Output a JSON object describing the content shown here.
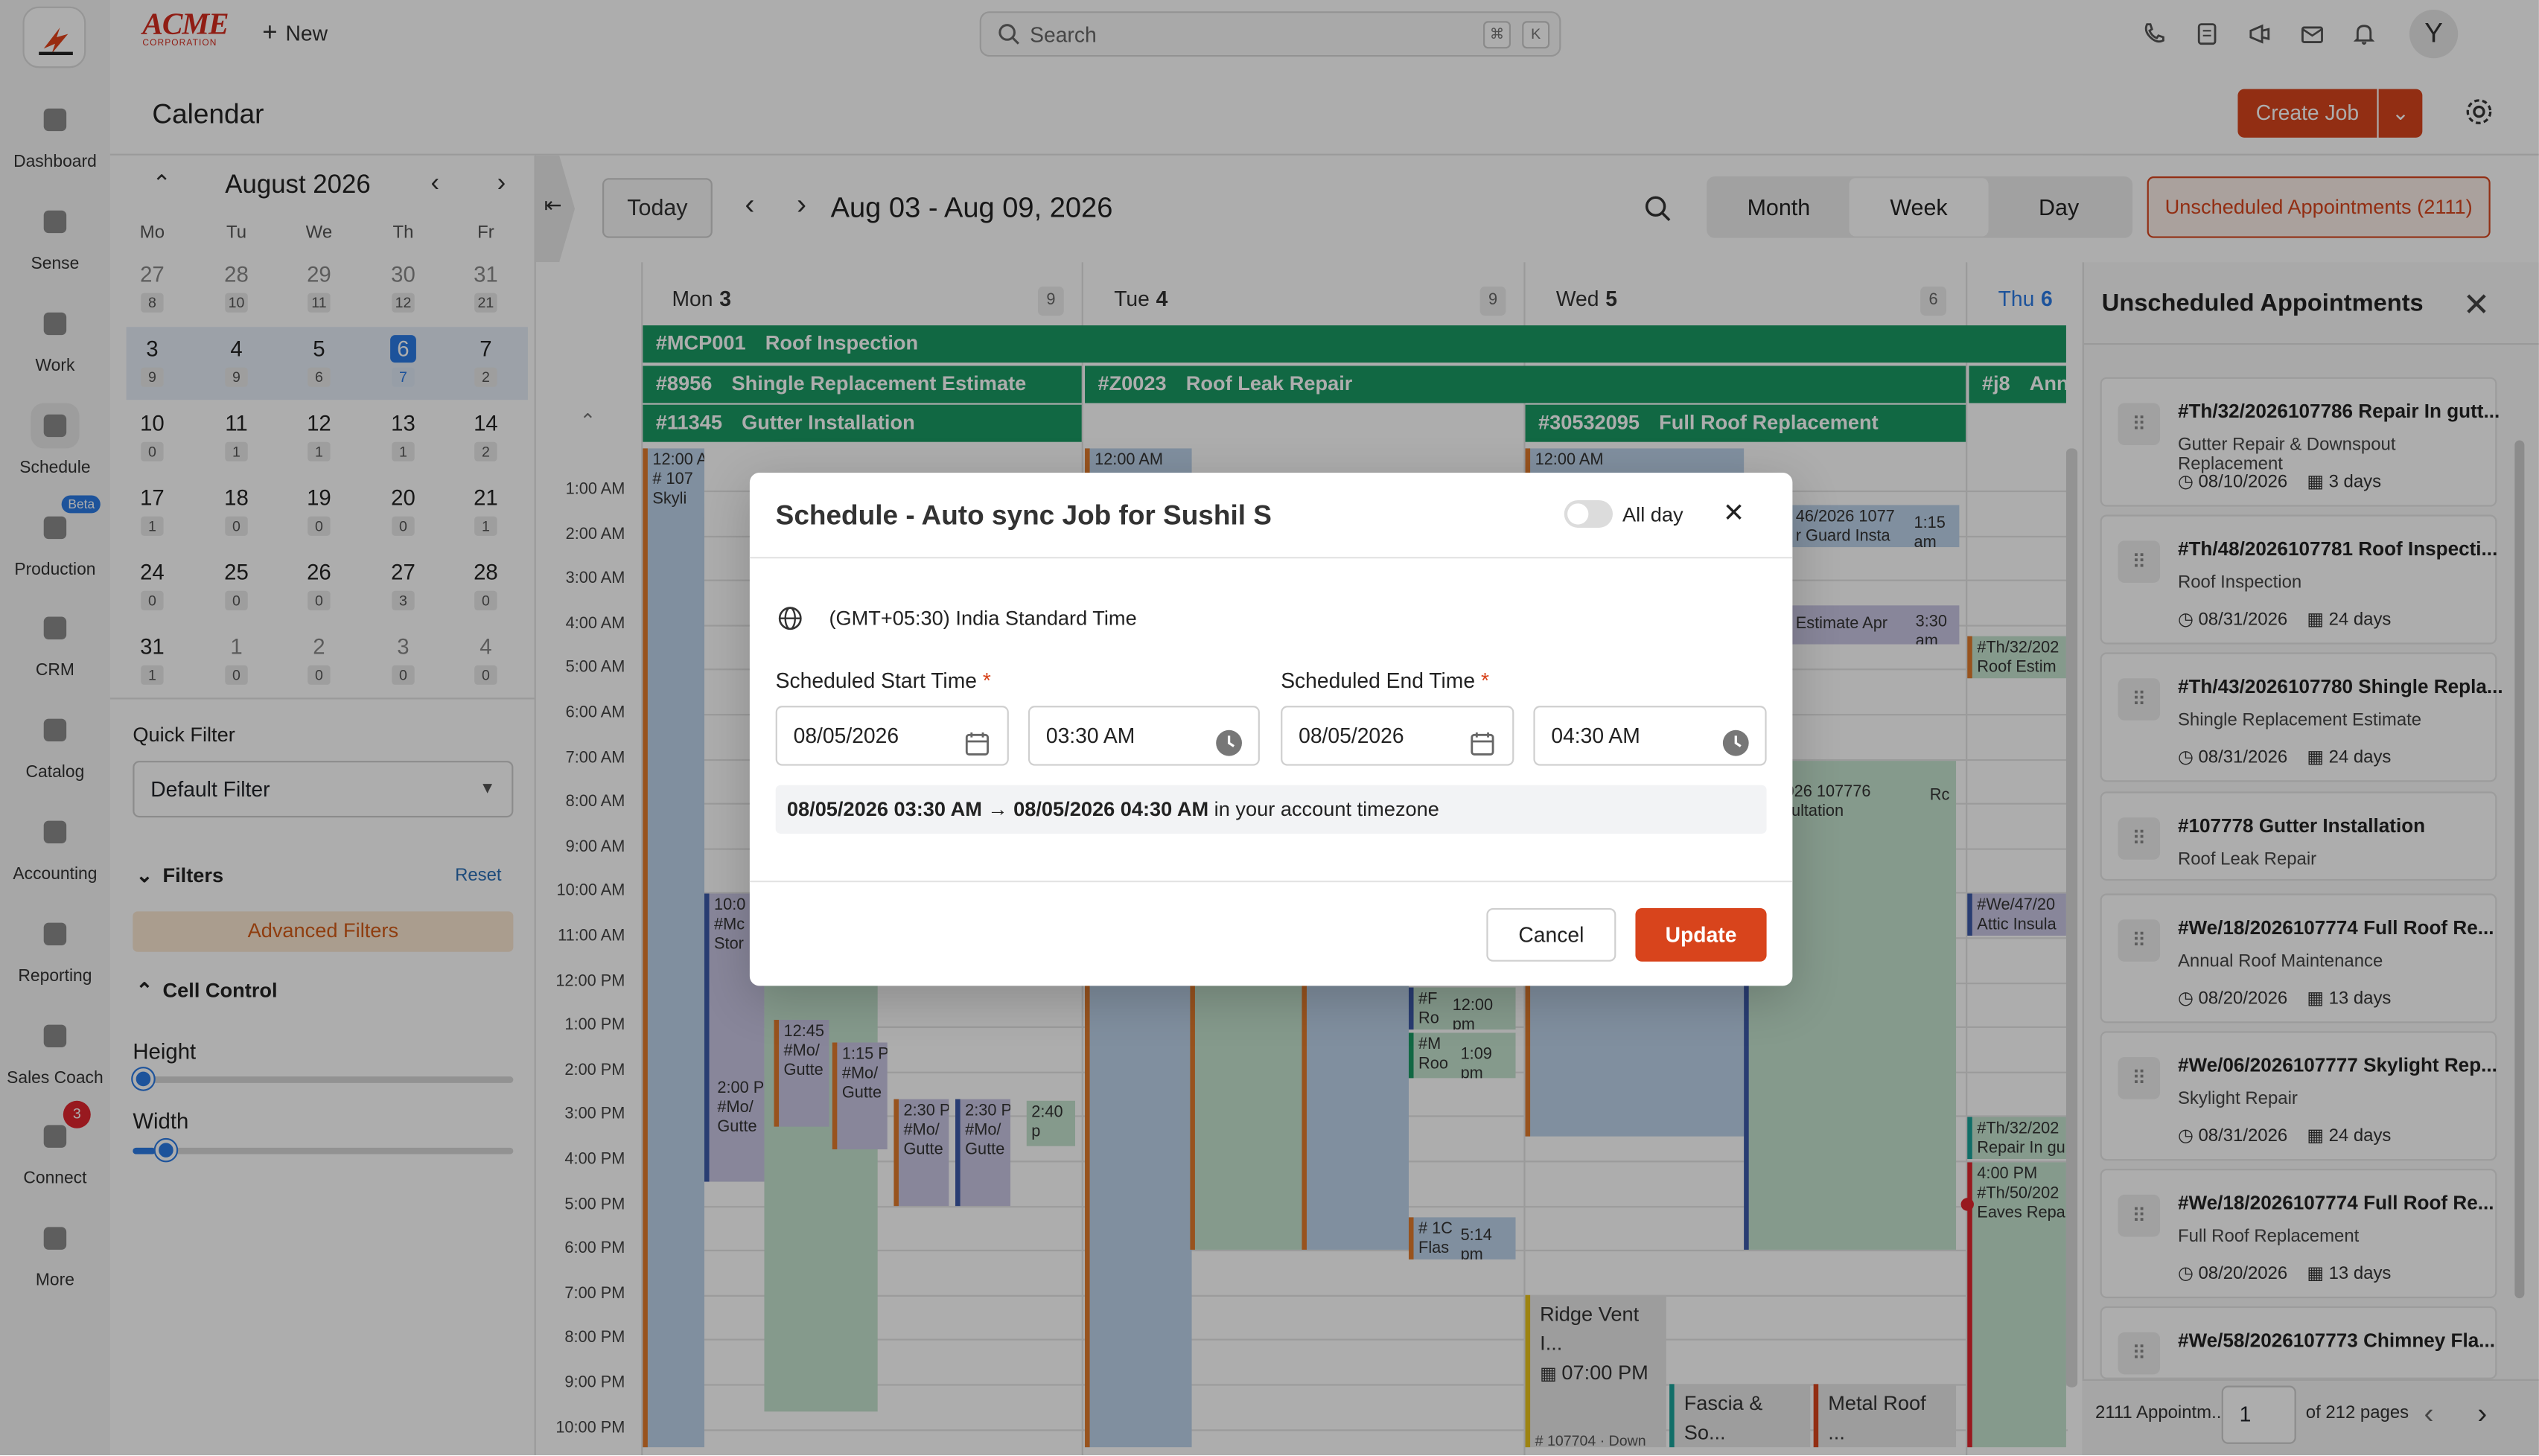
{
  "topbar": {
    "brand": "ACME",
    "brand_sub": "CORPORATION",
    "new_label": "New",
    "search_placeholder": "Search",
    "kbd1": "⌘",
    "kbd2": "K",
    "avatar": "Y"
  },
  "rail": [
    {
      "label": "Dashboard",
      "icon": "dashboard-icon"
    },
    {
      "label": "Sense",
      "icon": "grid-icon"
    },
    {
      "label": "Work",
      "icon": "briefcase-icon"
    },
    {
      "label": "Schedule",
      "icon": "calendar-icon"
    },
    {
      "label": "Production",
      "icon": "truck-icon",
      "badge": "Beta"
    },
    {
      "label": "CRM",
      "icon": "people-icon"
    },
    {
      "label": "Catalog",
      "icon": "tag-icon"
    },
    {
      "label": "Accounting",
      "icon": "ledger-icon"
    },
    {
      "label": "Reporting",
      "icon": "pie-chart-icon"
    },
    {
      "label": "Sales Coach",
      "icon": "coach-icon"
    },
    {
      "label": "Connect",
      "icon": "phone-icon",
      "badge": "3"
    },
    {
      "label": "More",
      "icon": "more-icon"
    }
  ],
  "header": {
    "title": "Calendar",
    "create_job": "Create Job"
  },
  "mini_calendar": {
    "month": "August 2026",
    "weekdays": [
      "Mo",
      "Tu",
      "We",
      "Th",
      "Fr"
    ],
    "weeks": [
      [
        {
          "d": "27",
          "c": "8",
          "dim": true
        },
        {
          "d": "28",
          "c": "10",
          "dim": true
        },
        {
          "d": "29",
          "c": "11",
          "dim": true
        },
        {
          "d": "30",
          "c": "12",
          "dim": true
        },
        {
          "d": "31",
          "c": "21",
          "dim": true
        }
      ],
      [
        {
          "d": "3",
          "c": "9"
        },
        {
          "d": "4",
          "c": "9"
        },
        {
          "d": "5",
          "c": "6"
        },
        {
          "d": "6",
          "c": "7",
          "sel": true
        },
        {
          "d": "7",
          "c": "2"
        }
      ],
      [
        {
          "d": "10",
          "c": "0"
        },
        {
          "d": "11",
          "c": "1"
        },
        {
          "d": "12",
          "c": "1"
        },
        {
          "d": "13",
          "c": "1"
        },
        {
          "d": "14",
          "c": "2"
        }
      ],
      [
        {
          "d": "17",
          "c": "1"
        },
        {
          "d": "18",
          "c": "0"
        },
        {
          "d": "19",
          "c": "0"
        },
        {
          "d": "20",
          "c": "0"
        },
        {
          "d": "21",
          "c": "1"
        }
      ],
      [
        {
          "d": "24",
          "c": "0"
        },
        {
          "d": "25",
          "c": "0"
        },
        {
          "d": "26",
          "c": "0"
        },
        {
          "d": "27",
          "c": "3"
        },
        {
          "d": "28",
          "c": "0"
        }
      ],
      [
        {
          "d": "31",
          "c": "1"
        },
        {
          "d": "1",
          "c": "0",
          "dim": true
        },
        {
          "d": "2",
          "c": "0",
          "dim": true
        },
        {
          "d": "3",
          "c": "0",
          "dim": true
        },
        {
          "d": "4",
          "c": "0",
          "dim": true
        }
      ]
    ]
  },
  "quick_filter": {
    "label": "Quick Filter",
    "value": "Default Filter"
  },
  "filters": {
    "label": "Filters",
    "reset": "Reset",
    "advanced": "Advanced Filters"
  },
  "cell_control": {
    "label": "Cell Control",
    "height": "Height",
    "width": "Width",
    "height_level": 0,
    "width_level": 0.06
  },
  "toolbar": {
    "today": "Today",
    "range": "Aug 03 - Aug 09, 2026",
    "views": [
      "Month",
      "Week",
      "Day"
    ],
    "active_view": "Week",
    "unscheduled": "Unscheduled Appointments (2111)"
  },
  "days": [
    {
      "name": "Mon",
      "num": "3",
      "count": "9"
    },
    {
      "name": "Tue",
      "num": "4",
      "count": "9"
    },
    {
      "name": "Wed",
      "num": "5",
      "count": "6"
    },
    {
      "name": "Thu",
      "num": "6",
      "count": ""
    }
  ],
  "allday_events": [
    {
      "id": "#MCP001",
      "title": "Roof Inspection"
    },
    {
      "id": "#8956",
      "title": "Shingle Replacement Estimate"
    },
    {
      "id": "#Z0023",
      "title": "Roof Leak Repair"
    },
    {
      "id": "#j8",
      "title": "Ann"
    },
    {
      "id": "#11345",
      "title": "Gutter Installation"
    },
    {
      "id": "#30532095",
      "title": "Full Roof Replacement"
    }
  ],
  "time_labels": [
    "1:00 AM",
    "2:00 AM",
    "3:00 AM",
    "4:00 AM",
    "5:00 AM",
    "6:00 AM",
    "7:00 AM",
    "8:00 AM",
    "9:00 AM",
    "10:00 AM",
    "11:00 AM",
    "12:00 PM",
    "1:00 PM",
    "2:00 PM",
    "3:00 PM",
    "4:00 PM",
    "5:00 PM",
    "6:00 PM",
    "7:00 PM",
    "8:00 PM",
    "9:00 PM",
    "10:00 PM"
  ],
  "grid_events": {
    "mon_a": "12:00 A\n# 107\nSkyli",
    "tue_a": "12:00 AM",
    "wed_a": "12:00 AM",
    "mon_b": "10:0\n#Mc\nStor",
    "mon_c": "2:00 P\n#Mo/\nGutte",
    "mon_d": "12:45 F\n#Mo/\nGutte",
    "mon_e": "1:15 PI\n#Mo/\nGutte",
    "mon_f": "2:30 PI\n#Mo/\nGutte",
    "mon_g": "2:30 PI\n#Mo/\nGutte",
    "mon_h": "2:40 p",
    "tue_b": "#F\nRo",
    "tue_b_time": "12:00 pm",
    "tue_c": "#M\nRoo",
    "tue_c_time": "1:09 pm",
    "tue_d": "# 1C\nFlas",
    "tue_d_time": "5:14 pm",
    "wed_b": "46/2026 1077\nr Guard Insta",
    "wed_b_time": "1:15 am",
    "wed_c": "Estimate Apr",
    "wed_c_time": "3:30 am",
    "wed_d": "AM\n56/2026 107776\nConsultation",
    "wed_d_tag": "Rc",
    "wed_ridge": "Ridge Vent I...",
    "wed_ridge_time": "07:00 PM",
    "wed_fascia": "Fascia & So...",
    "wed_metal": "Metal Roof ...",
    "wed_bottom": "# 107704 · Down",
    "thu_a": "#Th/32/202\nRoof Estim",
    "thu_b": "#We/47/20\nAttic Insula",
    "thu_c": "#Th/32/202\nRepair In gu",
    "thu_d": "4:00 PM\n#Th/50/202\nEaves Repa"
  },
  "unscheduled_panel": {
    "title": "Unscheduled Appointments",
    "cards": [
      {
        "title": "#Th/32/2026107786 Repair In gutt...",
        "sub": "Gutter Repair & Downspout Replacement",
        "date": "08/10/2026",
        "days": "3 days"
      },
      {
        "title": "#Th/48/2026107781 Roof Inspecti...",
        "sub": "Roof Inspection",
        "date": "08/31/2026",
        "days": "24 days"
      },
      {
        "title": "#Th/43/2026107780 Shingle Repla...",
        "sub": "Shingle Replacement Estimate",
        "date": "08/31/2026",
        "days": "24 days"
      },
      {
        "title": "#107778 Gutter Installation",
        "sub": "Roof Leak Repair",
        "date": "",
        "days": ""
      },
      {
        "title": "#We/18/2026107774 Full Roof Re...",
        "sub": "Annual Roof Maintenance",
        "date": "08/20/2026",
        "days": "13 days"
      },
      {
        "title": "#We/06/2026107777 Skylight Rep...",
        "sub": "Skylight Repair",
        "date": "08/31/2026",
        "days": "24 days"
      },
      {
        "title": "#We/18/2026107774 Full Roof Re...",
        "sub": "Full Roof Replacement",
        "date": "08/20/2026",
        "days": "13 days"
      },
      {
        "title": "#We/58/2026107773 Chimney Fla...",
        "sub": "",
        "date": "",
        "days": ""
      }
    ],
    "footer": {
      "count": "2111 Appointm...",
      "page": "1",
      "pages": "of 212 pages"
    }
  },
  "modal": {
    "title": "Schedule - Auto sync Job for Sushil S",
    "all_day": "All day",
    "timezone": "(GMT+05:30) India Standard Time",
    "start_label": "Scheduled Start Time",
    "end_label": "Scheduled End Time",
    "required": "*",
    "start_date": "08/05/2026",
    "start_time": "03:30 AM",
    "end_date": "08/05/2026",
    "end_time": "04:30 AM",
    "summary_bold": "08/05/2026 03:30 AM → 08/05/2026 04:30 AM",
    "summary_rest": "in your account timezone",
    "cancel": "Cancel",
    "update": "Update"
  },
  "colors": {
    "brand": "#d8441c",
    "green": "#1a9a63",
    "selected": "#2c7be5"
  }
}
